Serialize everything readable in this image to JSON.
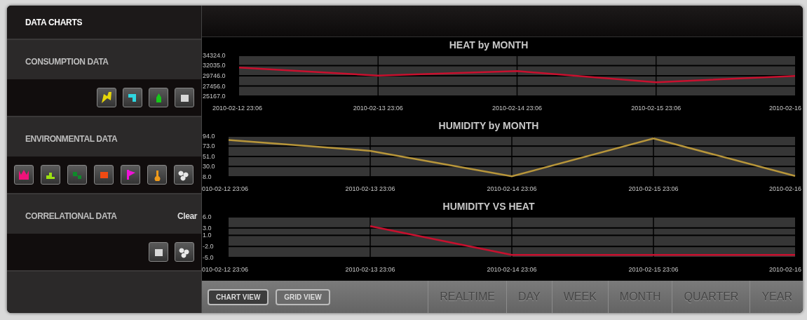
{
  "sidebar": {
    "title": "DATA CHARTS",
    "sections": [
      {
        "heading": "CONSUMPTION DATA",
        "icons": [
          {
            "color": "#e6d60a"
          },
          {
            "color": "#2fd6e0"
          },
          {
            "color": "#16c81a"
          },
          {
            "color": "#d8d8d8"
          }
        ]
      },
      {
        "heading": "ENVIRONMENTAL DATA",
        "icons": [
          {
            "color": "#f0127a"
          },
          {
            "color": "#9be012"
          },
          {
            "color": "#0f8a2a"
          },
          {
            "color": "#f04a12"
          },
          {
            "color": "#f012d8"
          },
          {
            "color": "#f09a1a"
          },
          {
            "color": "#e8e8e8"
          }
        ]
      },
      {
        "heading": "CORRELATIONAL DATA",
        "action": "Clear",
        "icons": [
          {
            "color": "#d8d8d8"
          },
          {
            "color": "#e8e8e8"
          }
        ]
      }
    ]
  },
  "charts": [
    {
      "chart_data": {
        "type": "line",
        "grid": true,
        "title": "HEAT by MONTH",
        "categories": [
          "2010-02-12 23:06",
          "2010-02-13 23:06",
          "2010-02-14 23:06",
          "2010-02-15 23:06",
          "2010-02-16"
        ],
        "ylim": [
          25167,
          34324
        ],
        "yticks": [
          {
            "value": 34324,
            "label": "34324.0"
          },
          {
            "value": 32035,
            "label": "32035.0"
          },
          {
            "value": 29746,
            "label": "29746.0"
          },
          {
            "value": 27456,
            "label": "27456.0"
          },
          {
            "value": 25167,
            "label": "25167.0"
          }
        ],
        "series": [
          {
            "color": "#c8102e",
            "values": [
              31600,
              29800,
              30800,
              28300,
              29700
            ]
          }
        ]
      }
    },
    {
      "chart_data": {
        "type": "line",
        "grid": true,
        "title": "HUMIDITY by MONTH",
        "categories": [
          "010-02-12 23:06",
          "2010-02-13 23:06",
          "2010-02-14 23:06",
          "2010-02-15 23:06",
          "2010-02-16"
        ],
        "ylim": [
          8,
          94
        ],
        "yticks": [
          {
            "value": 94,
            "label": "94.0"
          },
          {
            "value": 73,
            "label": "73.0"
          },
          {
            "value": 51,
            "label": "51.0"
          },
          {
            "value": 30,
            "label": "30.0"
          },
          {
            "value": 8,
            "label": "8.0"
          }
        ],
        "series": [
          {
            "color": "#b8963a",
            "values": [
              86,
              63,
              9,
              89,
              10
            ]
          }
        ]
      }
    },
    {
      "chart_data": {
        "type": "line",
        "grid": true,
        "title": "HUMIDITY VS HEAT",
        "categories": [
          "010-02-12 23:06",
          "2010-02-13 23:06",
          "2010-02-14 23:06",
          "2010-02-15 23:06",
          "2010-02-16"
        ],
        "ylim": [
          -5,
          6
        ],
        "yticks": [
          {
            "value": 6,
            "label": "6.0"
          },
          {
            "value": 3,
            "label": "3.0"
          },
          {
            "value": 1,
            "label": "1.0"
          },
          {
            "value": -2,
            "label": "-2.0"
          },
          {
            "value": -5,
            "label": "-5.0"
          }
        ],
        "series": [
          {
            "color": "#c8102e",
            "values": [
              null,
              3.5,
              -4.3,
              -4.3,
              -4.3
            ]
          }
        ]
      }
    }
  ],
  "view_buttons": [
    {
      "label": "CHART VIEW",
      "selected": true
    },
    {
      "label": "GRID VIEW",
      "selected": false
    }
  ],
  "periods": [
    {
      "label": "REALTIME",
      "selected": false
    },
    {
      "label": "DAY",
      "selected": false
    },
    {
      "label": "WEEK",
      "selected": false
    },
    {
      "label": "MONTH",
      "selected": false
    },
    {
      "label": "QUARTER",
      "selected": false
    },
    {
      "label": "YEAR",
      "selected": false
    }
  ]
}
